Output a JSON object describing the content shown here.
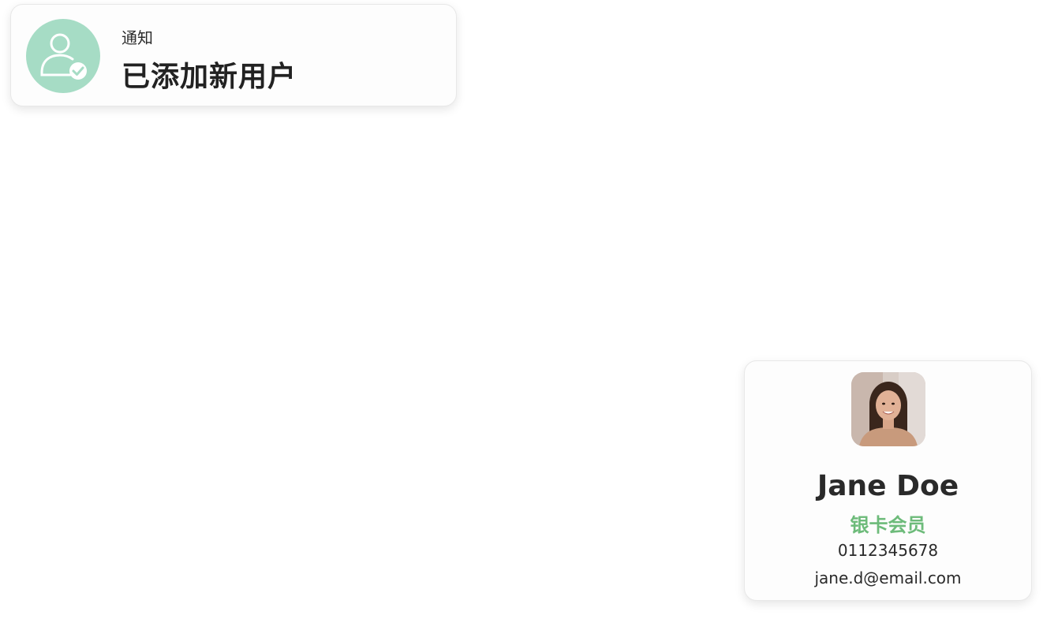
{
  "notification": {
    "label": "通知",
    "title": "已添加新用户",
    "icon": "user-added-icon",
    "icon_bg_color": "#a6dcc5"
  },
  "profile": {
    "name": "Jane Doe",
    "tier": "银卡会员",
    "tier_color": "#6dbb7a",
    "phone": "0112345678",
    "email": "jane.d@email.com",
    "avatar": "user-photo"
  }
}
